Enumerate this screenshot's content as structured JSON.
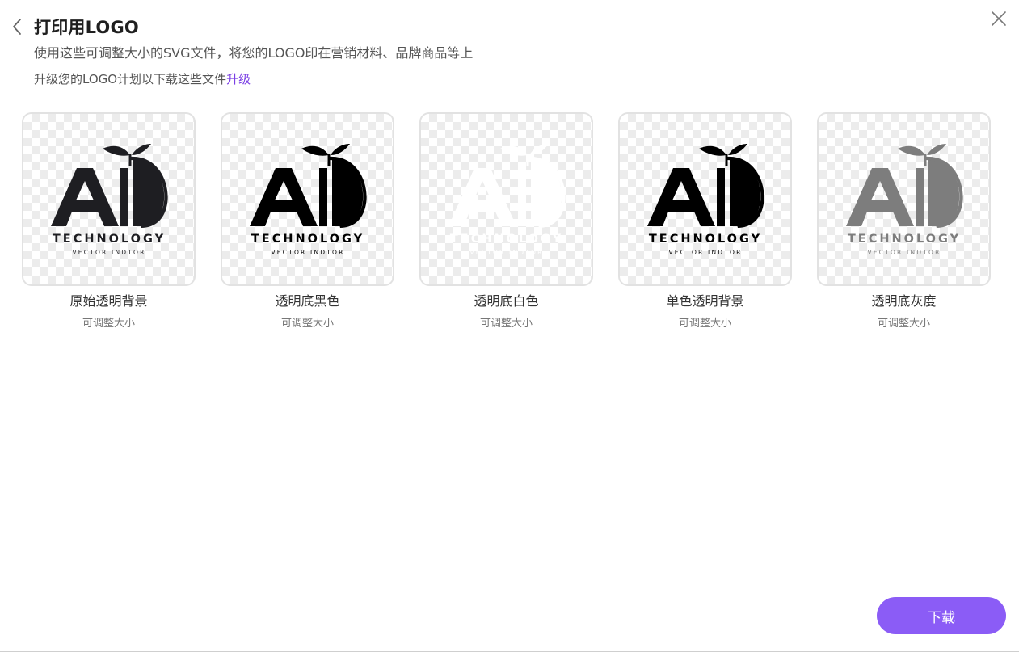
{
  "header": {
    "title": "打印用LOGO",
    "subtitle": "使用这些可调整大小的SVG文件，将您的LOGO印在营销材料、品牌商品等上",
    "upgrade_text": "升级您的LOGO计划以下载这些文件",
    "upgrade_link": "升级"
  },
  "logo": {
    "main_text": "TECHNOLOGY",
    "sub_text": "VECTOR INDTOR"
  },
  "options": [
    {
      "label": "原始透明背景",
      "sub": "可调整大小",
      "color": "#1e1e22"
    },
    {
      "label": "透明底黑色",
      "sub": "可调整大小",
      "color": "#000000"
    },
    {
      "label": "透明底白色",
      "sub": "可调整大小",
      "color": "#ffffff"
    },
    {
      "label": "单色透明背景",
      "sub": "可调整大小",
      "color": "#000000"
    },
    {
      "label": "透明底灰度",
      "sub": "可调整大小",
      "color": "#7d7d7d"
    }
  ],
  "footer": {
    "download_label": "下载"
  },
  "colors": {
    "accent": "#8b5cf6",
    "link": "#7b3fe4"
  },
  "icons": {
    "back": "chevron-left-icon",
    "close": "close-icon"
  }
}
